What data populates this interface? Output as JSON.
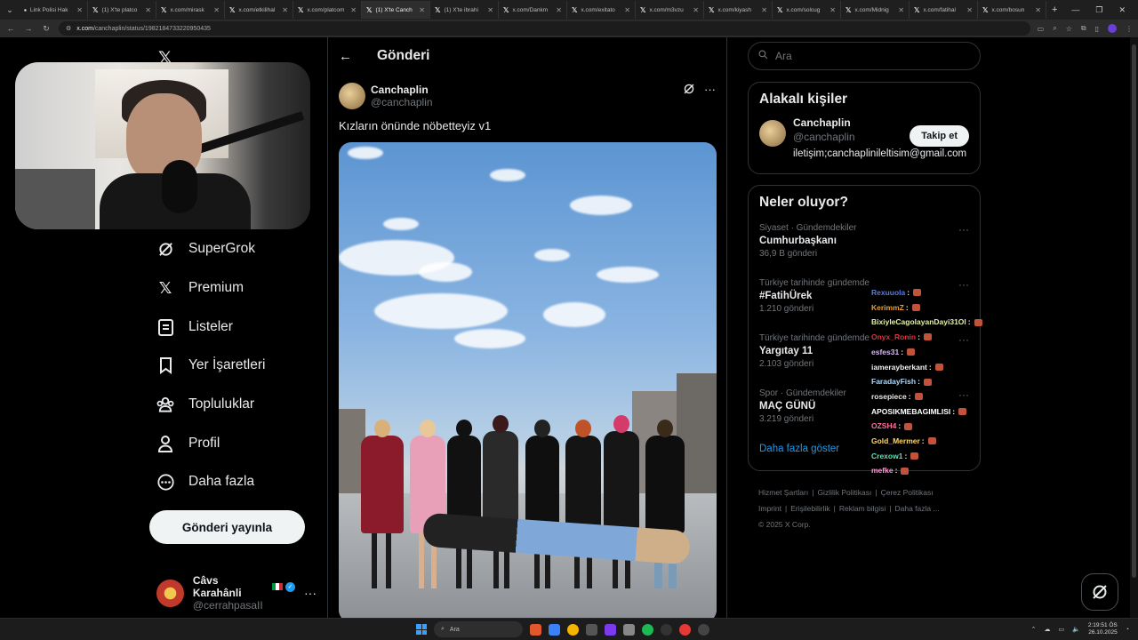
{
  "browser": {
    "tabs": [
      {
        "label": "Link Polisi Hak",
        "icon": "page-icon"
      },
      {
        "label": "(1) X'te platco",
        "icon": "x-logo-icon"
      },
      {
        "label": "x.com/mirask",
        "icon": "x-logo-icon"
      },
      {
        "label": "x.com/etkilihal",
        "icon": "x-logo-icon"
      },
      {
        "label": "x.com/platcom",
        "icon": "x-logo-icon"
      },
      {
        "label": "(1) X'te Canch",
        "icon": "x-logo-icon",
        "active": true
      },
      {
        "label": "(1) X'te ibrahi",
        "icon": "x-logo-icon"
      },
      {
        "label": "x.com/Dankm",
        "icon": "x-logo-icon"
      },
      {
        "label": "x.com/exitato",
        "icon": "x-logo-icon"
      },
      {
        "label": "x.com/m3vzu",
        "icon": "x-logo-icon"
      },
      {
        "label": "x.com/kiyash",
        "icon": "x-logo-icon"
      },
      {
        "label": "x.com/solcug",
        "icon": "x-logo-icon"
      },
      {
        "label": "x.com/Midnig",
        "icon": "x-logo-icon"
      },
      {
        "label": "x.com/fatihal",
        "icon": "x-logo-icon"
      },
      {
        "label": "x.com/bosun",
        "icon": "x-logo-icon"
      }
    ],
    "url_host": "x.com",
    "url_path": "/canchaplin/status/1982184733220950435"
  },
  "nav": {
    "items": [
      {
        "label": "SuperGrok",
        "icon": "grok-icon"
      },
      {
        "label": "Premium",
        "icon": "x-logo-icon"
      },
      {
        "label": "Listeler",
        "icon": "list-icon"
      },
      {
        "label": "Yer İşaretleri",
        "icon": "bookmark-icon"
      },
      {
        "label": "Topluluklar",
        "icon": "communities-icon"
      },
      {
        "label": "Profil",
        "icon": "profile-icon"
      },
      {
        "label": "Daha fazla",
        "icon": "more-circle-icon"
      }
    ],
    "post_button": "Gönderi yayınla",
    "account": {
      "name": "Câvs Karahânli",
      "handle": "@cerrahpasaII"
    }
  },
  "post": {
    "header_title": "Gönderi",
    "author_name": "Canchaplin",
    "author_handle": "@canchaplin",
    "text": "Kızların önünde nöbetteyiz v1"
  },
  "sidebar": {
    "search_placeholder": "Ara",
    "related_title": "Alakalı kişiler",
    "related": {
      "name": "Canchaplin",
      "handle": "@canchaplin",
      "bio": "iletişim;canchaplinileltisim@gmail.com",
      "follow_label": "Takip et"
    },
    "trends_title": "Neler oluyor?",
    "trends": [
      {
        "meta": "Siyaset · Gündemdekiler",
        "name": "Cumhurbaşkanı",
        "count": "36,9 B gönderi"
      },
      {
        "meta": "Türkiye tarihinde gündemde",
        "name": "#FatihÜrek",
        "count": "1.210 gönderi"
      },
      {
        "meta": "Türkiye tarihinde gündemde",
        "name": "Yargıtay 11",
        "count": "2.103 gönderi"
      },
      {
        "meta": "Spor · Gündemdekiler",
        "name": "MAÇ GÜNÜ",
        "count": "3.219 gönderi"
      }
    ],
    "show_more": "Daha fazla göster",
    "footer": [
      "Hizmet Şartları",
      "Gizlilik Politikası",
      "Çerez Politikası",
      "Imprint",
      "Erişilebilirlik",
      "Reklam bilgisi",
      "Daha fazla ..."
    ],
    "copyright": "© 2025 X Corp."
  },
  "chat": [
    {
      "user": "Rexuuola",
      "color": "#5b7bd5"
    },
    {
      "user": "KerimmZ",
      "color": "#f0a020"
    },
    {
      "user": "BixiyleCagolayanDayi31Ol",
      "color": "#e6f0a0"
    },
    {
      "user": "Onyx_Ronin",
      "color": "#e0303c"
    },
    {
      "user": "esfes31",
      "color": "#d4b8f0"
    },
    {
      "user": "iamerayberkant",
      "color": "#f0f0f0"
    },
    {
      "user": "FaradayFish",
      "color": "#a8d8ff"
    },
    {
      "user": "rosepiece",
      "color": "#e8e8e8"
    },
    {
      "user": "APOSIKMEBAGIMLISI",
      "color": "#ffffff"
    },
    {
      "user": "OZSH4",
      "color": "#ff6fa0"
    },
    {
      "user": "Gold_Mermer",
      "color": "#ffd966"
    },
    {
      "user": "Crexow1",
      "color": "#5fe3b0"
    },
    {
      "user": "mefke",
      "color": "#ff9ad5"
    }
  ],
  "taskbar": {
    "search_label": "Ara",
    "time": "2:19:51 ÖS",
    "date": "26.10.2025"
  }
}
